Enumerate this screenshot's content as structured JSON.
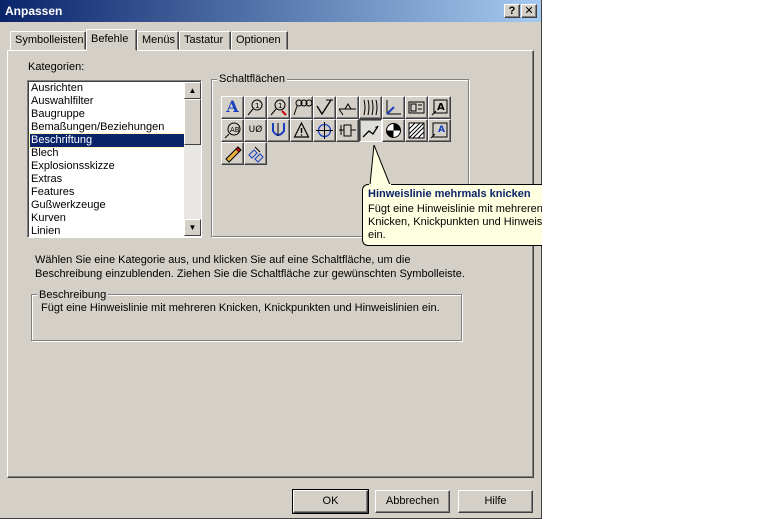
{
  "window": {
    "title": "Anpassen",
    "help_button": "?",
    "close_button": "✕"
  },
  "tabs": [
    {
      "label": "Symbolleisten"
    },
    {
      "label": "Befehle"
    },
    {
      "label": "Menüs"
    },
    {
      "label": "Tastatur"
    },
    {
      "label": "Optionen"
    }
  ],
  "categories": {
    "label": "Kategorien:",
    "items": [
      "Ausrichten",
      "Auswahlfilter",
      "Baugruppe",
      "Bemaßungen/Beziehungen",
      "Beschriftung",
      "Blech",
      "Explosionsskizze",
      "Extras",
      "Features",
      "Gußwerkzeuge",
      "Kurven",
      "Linien"
    ],
    "selected": "Beschriftung"
  },
  "buttons_group": {
    "label": "Schaltflächen",
    "icons": [
      "note-icon",
      "balloon-icon",
      "auto-balloon-icon",
      "multi-jog-balloon-icon",
      "surface-finish-icon",
      "weld-symbol-icon",
      "cosmetic-thread-icon",
      "datum-feature-icon",
      "hole-callout-icon",
      "datum-target-icon",
      "stacked-balloon-icon",
      "dimension-text-icon",
      "geometric-tolerance-icon",
      "warning-icon",
      "center-mark-icon",
      "datum-symbol-icon",
      "multi-jog-leader-icon",
      "centroid-icon",
      "area-hatch-icon",
      "block-icon",
      "revision-symbol-icon",
      "magnet-line-icon"
    ],
    "pressed_icon": "multi-jog-leader-icon",
    "icon_glyphs": {
      "ub_text": "UØ"
    }
  },
  "tooltip": {
    "title": "Hinweislinie mehrmals knicken",
    "body": "Fügt eine Hinweislinie mit mehreren Knicken, Knickpunkten und Hinweislinien ein."
  },
  "instruction": "Wählen Sie eine Kategorie aus, und klicken Sie auf eine Schaltfläche, um die Beschreibung einzublenden. Ziehen Sie die Schaltfläche zur gewünschten Symbolleiste.",
  "description": {
    "label": "Beschreibung",
    "text": "Fügt eine Hinweislinie mit mehreren Knicken, Knickpunkten und Hinweislinien ein."
  },
  "footer": {
    "ok": "OK",
    "cancel": "Abbrechen",
    "help": "Hilfe"
  },
  "colors": {
    "title_start": "#0a246a",
    "title_end": "#a6caf0",
    "face": "#d4d0c8",
    "tooltip_bg": "#ffffe1",
    "tooltip_title": "#0a246a"
  }
}
